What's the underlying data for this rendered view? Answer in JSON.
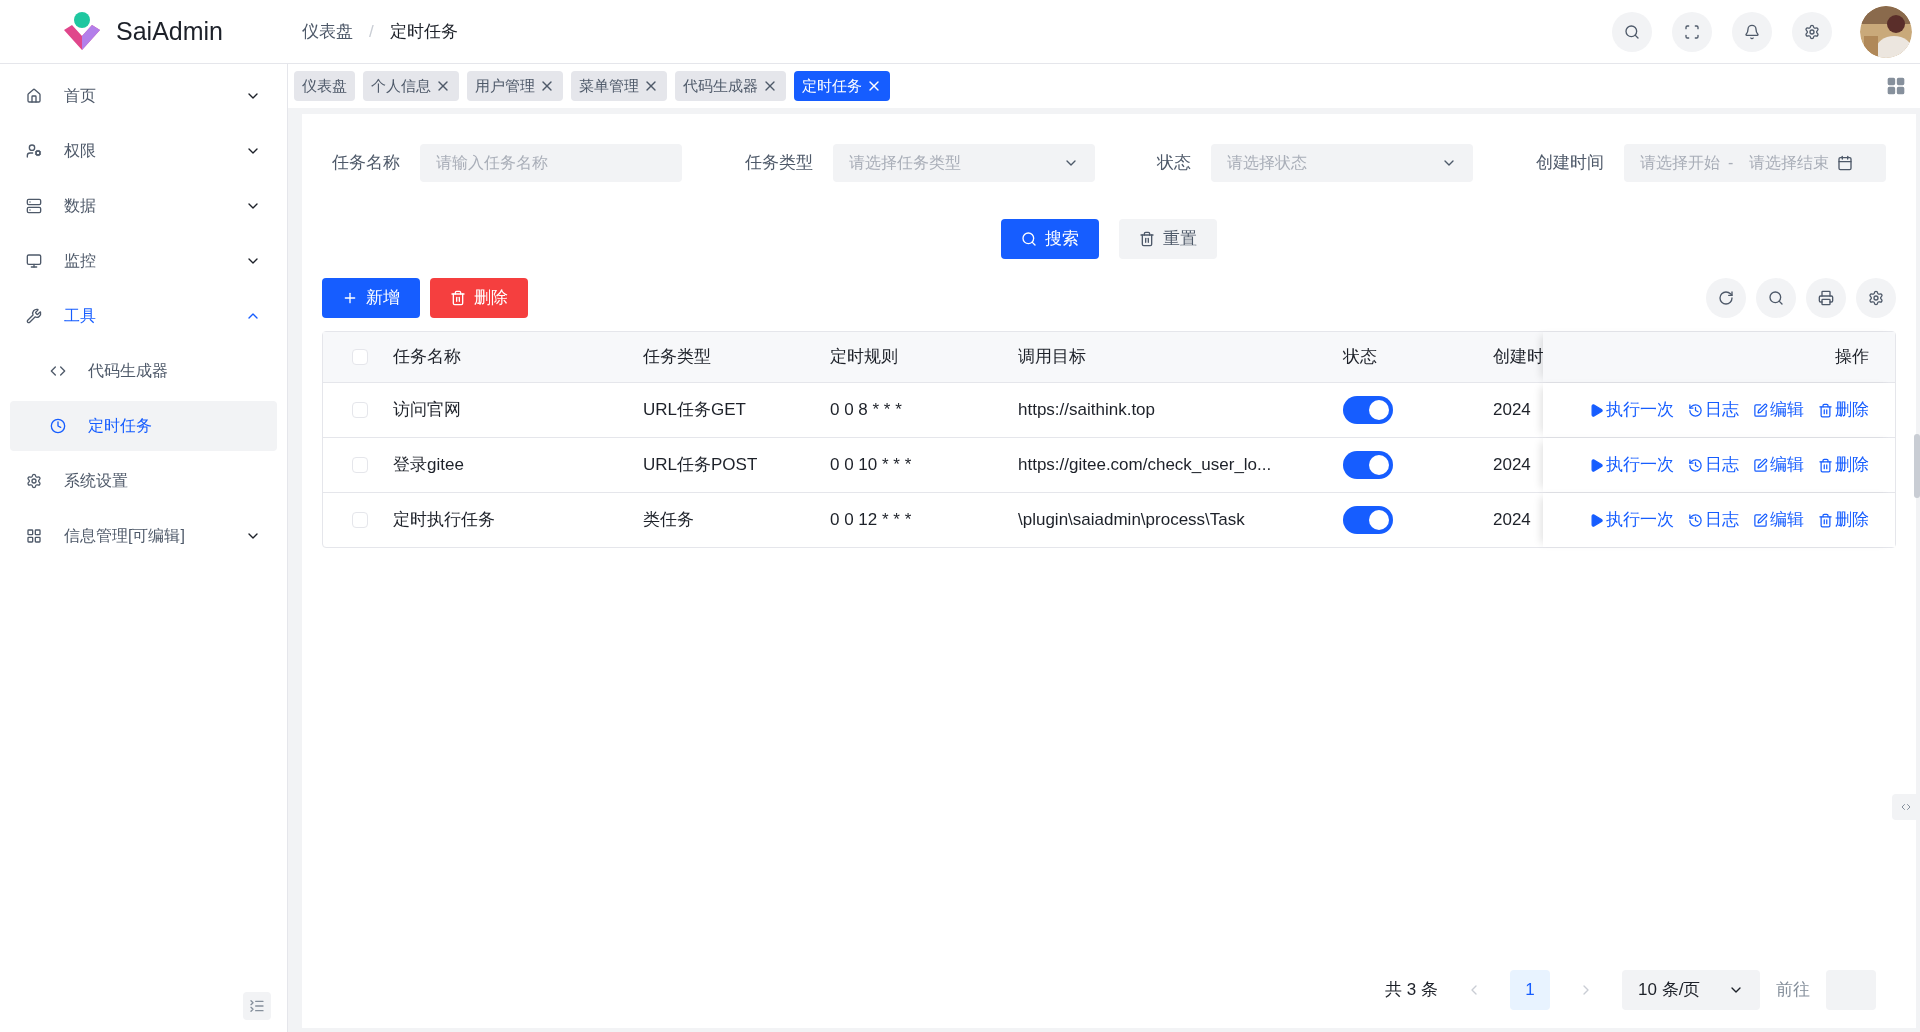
{
  "logo": {
    "title": "SaiAdmin"
  },
  "breadcrumb": [
    "仪表盘",
    "/",
    "定时任务"
  ],
  "sidebar": {
    "items": [
      {
        "label": "首页",
        "expanded": false,
        "selected": false
      },
      {
        "label": "权限",
        "expanded": false,
        "selected": false
      },
      {
        "label": "数据",
        "expanded": false,
        "selected": false
      },
      {
        "label": "监控",
        "expanded": false,
        "selected": false
      },
      {
        "label": "工具",
        "expanded": true,
        "selected": true,
        "children": [
          {
            "label": "代码生成器",
            "selected": false
          },
          {
            "label": "定时任务",
            "selected": true
          }
        ]
      },
      {
        "label": "系统设置",
        "selected": false
      },
      {
        "label": "信息管理[可编辑]",
        "expanded": false,
        "selected": false
      }
    ]
  },
  "tabs": [
    {
      "label": "仪表盘",
      "closable": false,
      "selected": false
    },
    {
      "label": "个人信息",
      "closable": true,
      "selected": false
    },
    {
      "label": "用户管理",
      "closable": true,
      "selected": false
    },
    {
      "label": "菜单管理",
      "closable": true,
      "selected": false
    },
    {
      "label": "代码生成器",
      "closable": true,
      "selected": false
    },
    {
      "label": "定时任务",
      "closable": true,
      "selected": true
    }
  ],
  "filters": [
    {
      "label": "任务名称",
      "kind": "input",
      "placeholder": "请输入任务名称"
    },
    {
      "label": "任务类型",
      "kind": "select",
      "placeholder": "请选择任务类型"
    },
    {
      "label": "状态",
      "kind": "select",
      "placeholder": "请选择状态"
    },
    {
      "label": "创建时间",
      "kind": "range",
      "placeholder": "请选择开始",
      "separator": "-",
      "placeholder_end": "请选择结束"
    }
  ],
  "search_buttons": [
    "搜索",
    "重置"
  ],
  "actions": [
    "新增",
    "删除"
  ],
  "table": {
    "all_checked": false,
    "columns": [
      "任务名称",
      "任务类型",
      "定时规则",
      "调用目标",
      "状态",
      "创建时",
      "操作"
    ],
    "rows": [
      {
        "checked": false,
        "cells": [
          "访问官网",
          "URL任务GET",
          "0 0 8 * * *",
          "https://saithink.top"
        ],
        "on": true,
        "created": "2024",
        "actions": [
          "执行一次",
          "日志",
          "编辑",
          "删除"
        ]
      },
      {
        "checked": false,
        "cells": [
          "登录gitee",
          "URL任务POST",
          "0 0 10 * * *",
          "https://gitee.com/check_user_lo..."
        ],
        "on": true,
        "created": "2024",
        "actions": [
          "执行一次",
          "日志",
          "编辑",
          "删除"
        ]
      },
      {
        "checked": false,
        "cells": [
          "定时执行任务",
          "类任务",
          "0 0 12 * * *",
          "\\plugin\\saiadmin\\process\\Task"
        ],
        "on": true,
        "created": "2024",
        "actions": [
          "执行一次",
          "日志",
          "编辑",
          "删除"
        ]
      }
    ]
  },
  "pagination": {
    "total": "共 3 条",
    "pages": [
      {
        "label": "1",
        "selected": true
      }
    ],
    "page_size": "10 条/页",
    "goto": "前往"
  }
}
